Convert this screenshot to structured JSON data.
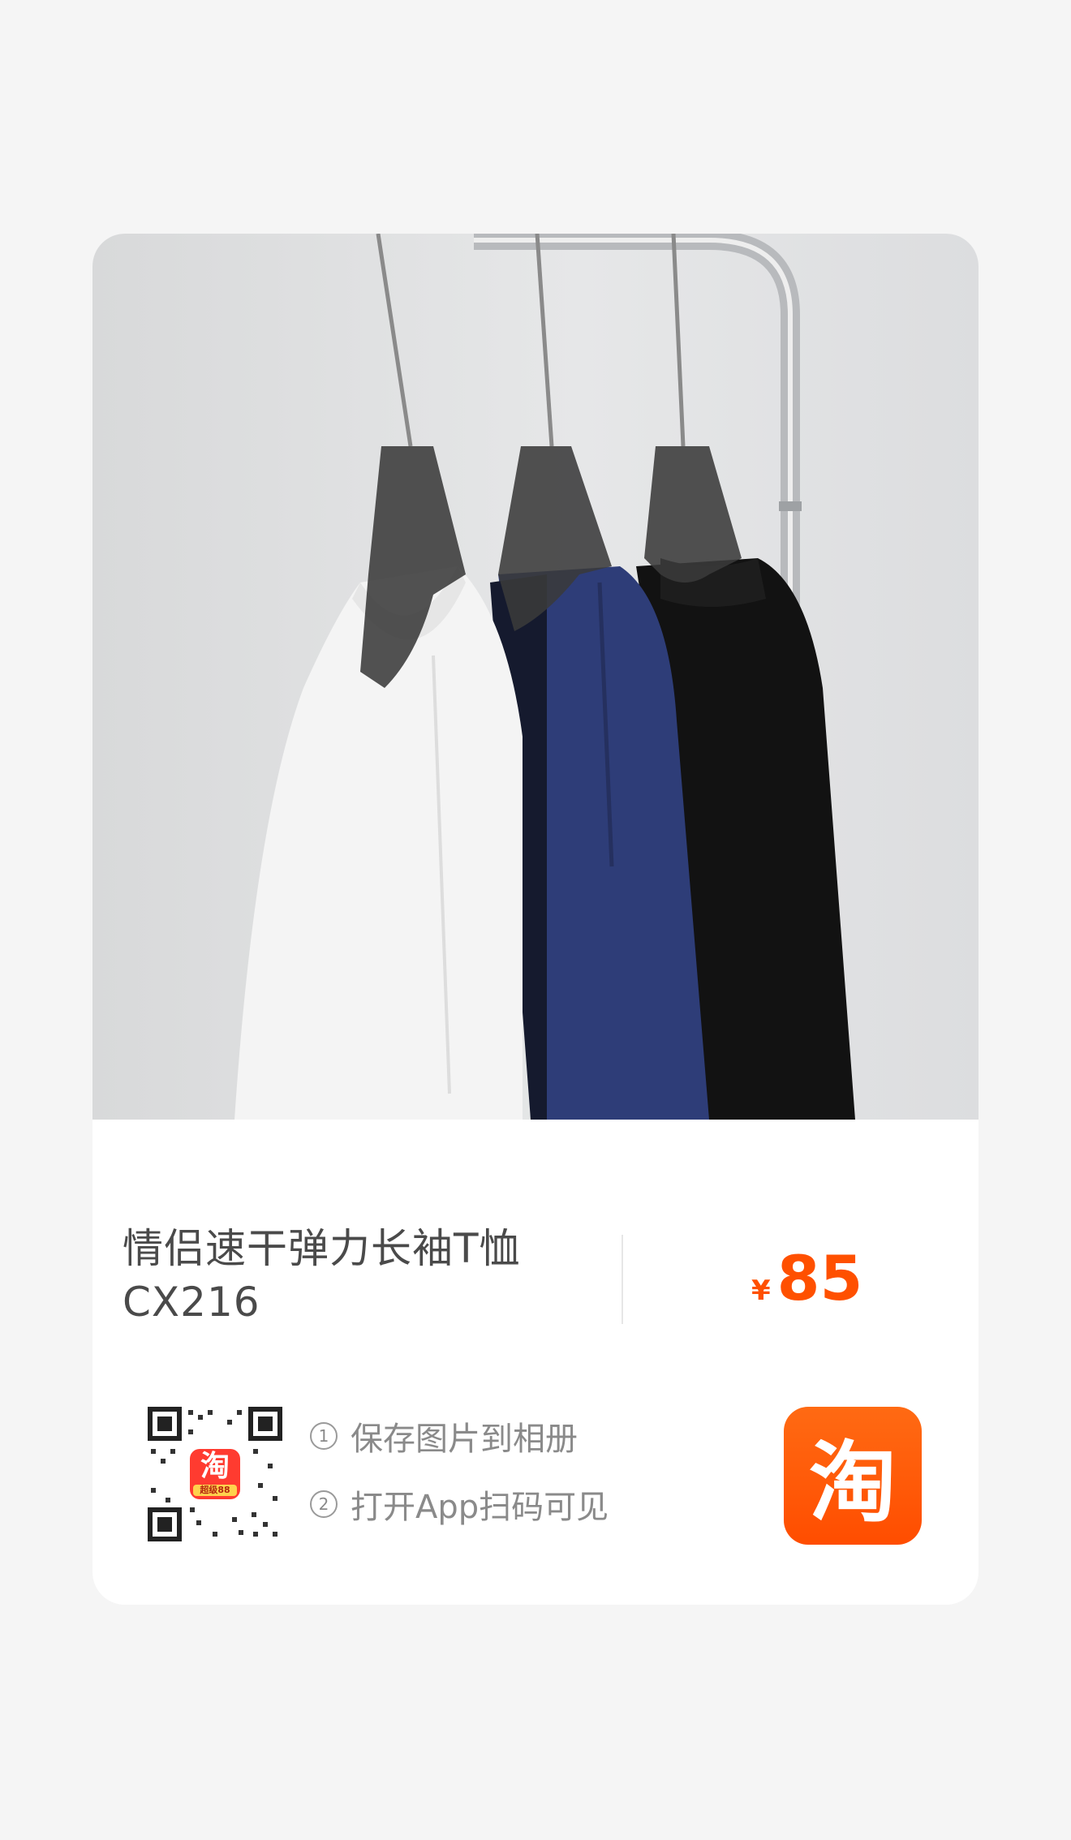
{
  "product": {
    "title": "情侣速干弹力长袖T恤 CX216",
    "price_symbol": "¥",
    "price": "85"
  },
  "share": {
    "step1_num": "1",
    "step1_text": "保存图片到相册",
    "step2_num": "2",
    "step2_text": "打开App扫码可见"
  },
  "qr": {
    "center_logo_glyph": "淘",
    "center_logo_caption": "超级88"
  },
  "app_icon": {
    "glyph": "淘",
    "name": "taobao-icon"
  },
  "colors": {
    "price": "#ff5000",
    "app_icon": "#ff5a0a",
    "garment_white": "#f4f4f4",
    "garment_navy": "#2e3d78",
    "garment_black": "#111111"
  },
  "photo": {
    "image_description_shirts": [
      "white",
      "navy",
      "black"
    ]
  }
}
